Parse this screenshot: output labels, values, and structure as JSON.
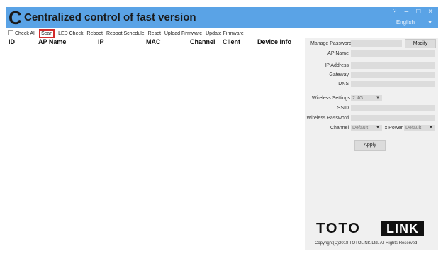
{
  "app": {
    "logo_letter": "C",
    "title": "Centralized control of fast version",
    "window_controls": [
      "?",
      "–",
      "□",
      "×"
    ],
    "language": "English"
  },
  "toolbar": {
    "check_all": "Check All",
    "items": [
      "Scan",
      "LED Check",
      "Reboot",
      "Reboot Schedule",
      "Reset",
      "Upload Firmware",
      "Update Firmware"
    ],
    "highlighted": "Scan"
  },
  "table": {
    "columns": [
      "ID",
      "AP Name",
      "IP",
      "MAC",
      "Channel",
      "Client",
      "Device Info"
    ],
    "rows": []
  },
  "settings": {
    "manage_password": "Manage Password",
    "modify": "Modify",
    "ap_name": "AP Name",
    "ip_address": "IP Address",
    "gateway": "Gateway",
    "dns": "DNS",
    "wireless_settings": "Wireless Settings",
    "band": "2.4G",
    "ssid": "SSID",
    "wireless_password": "Wireless Password",
    "channel": "Channel",
    "channel_value": "Default",
    "tx_power": "Tx Power",
    "tx_power_value": "Default",
    "apply": "Apply"
  },
  "brand": {
    "toto": "TOTO",
    "link": "LINK",
    "copyright": "Copyright(C)2018 TOTOLINK Ltd. All Rights Reserved"
  },
  "colors": {
    "titlebar": "#5aa3e6",
    "highlight": "#d22b2b"
  }
}
